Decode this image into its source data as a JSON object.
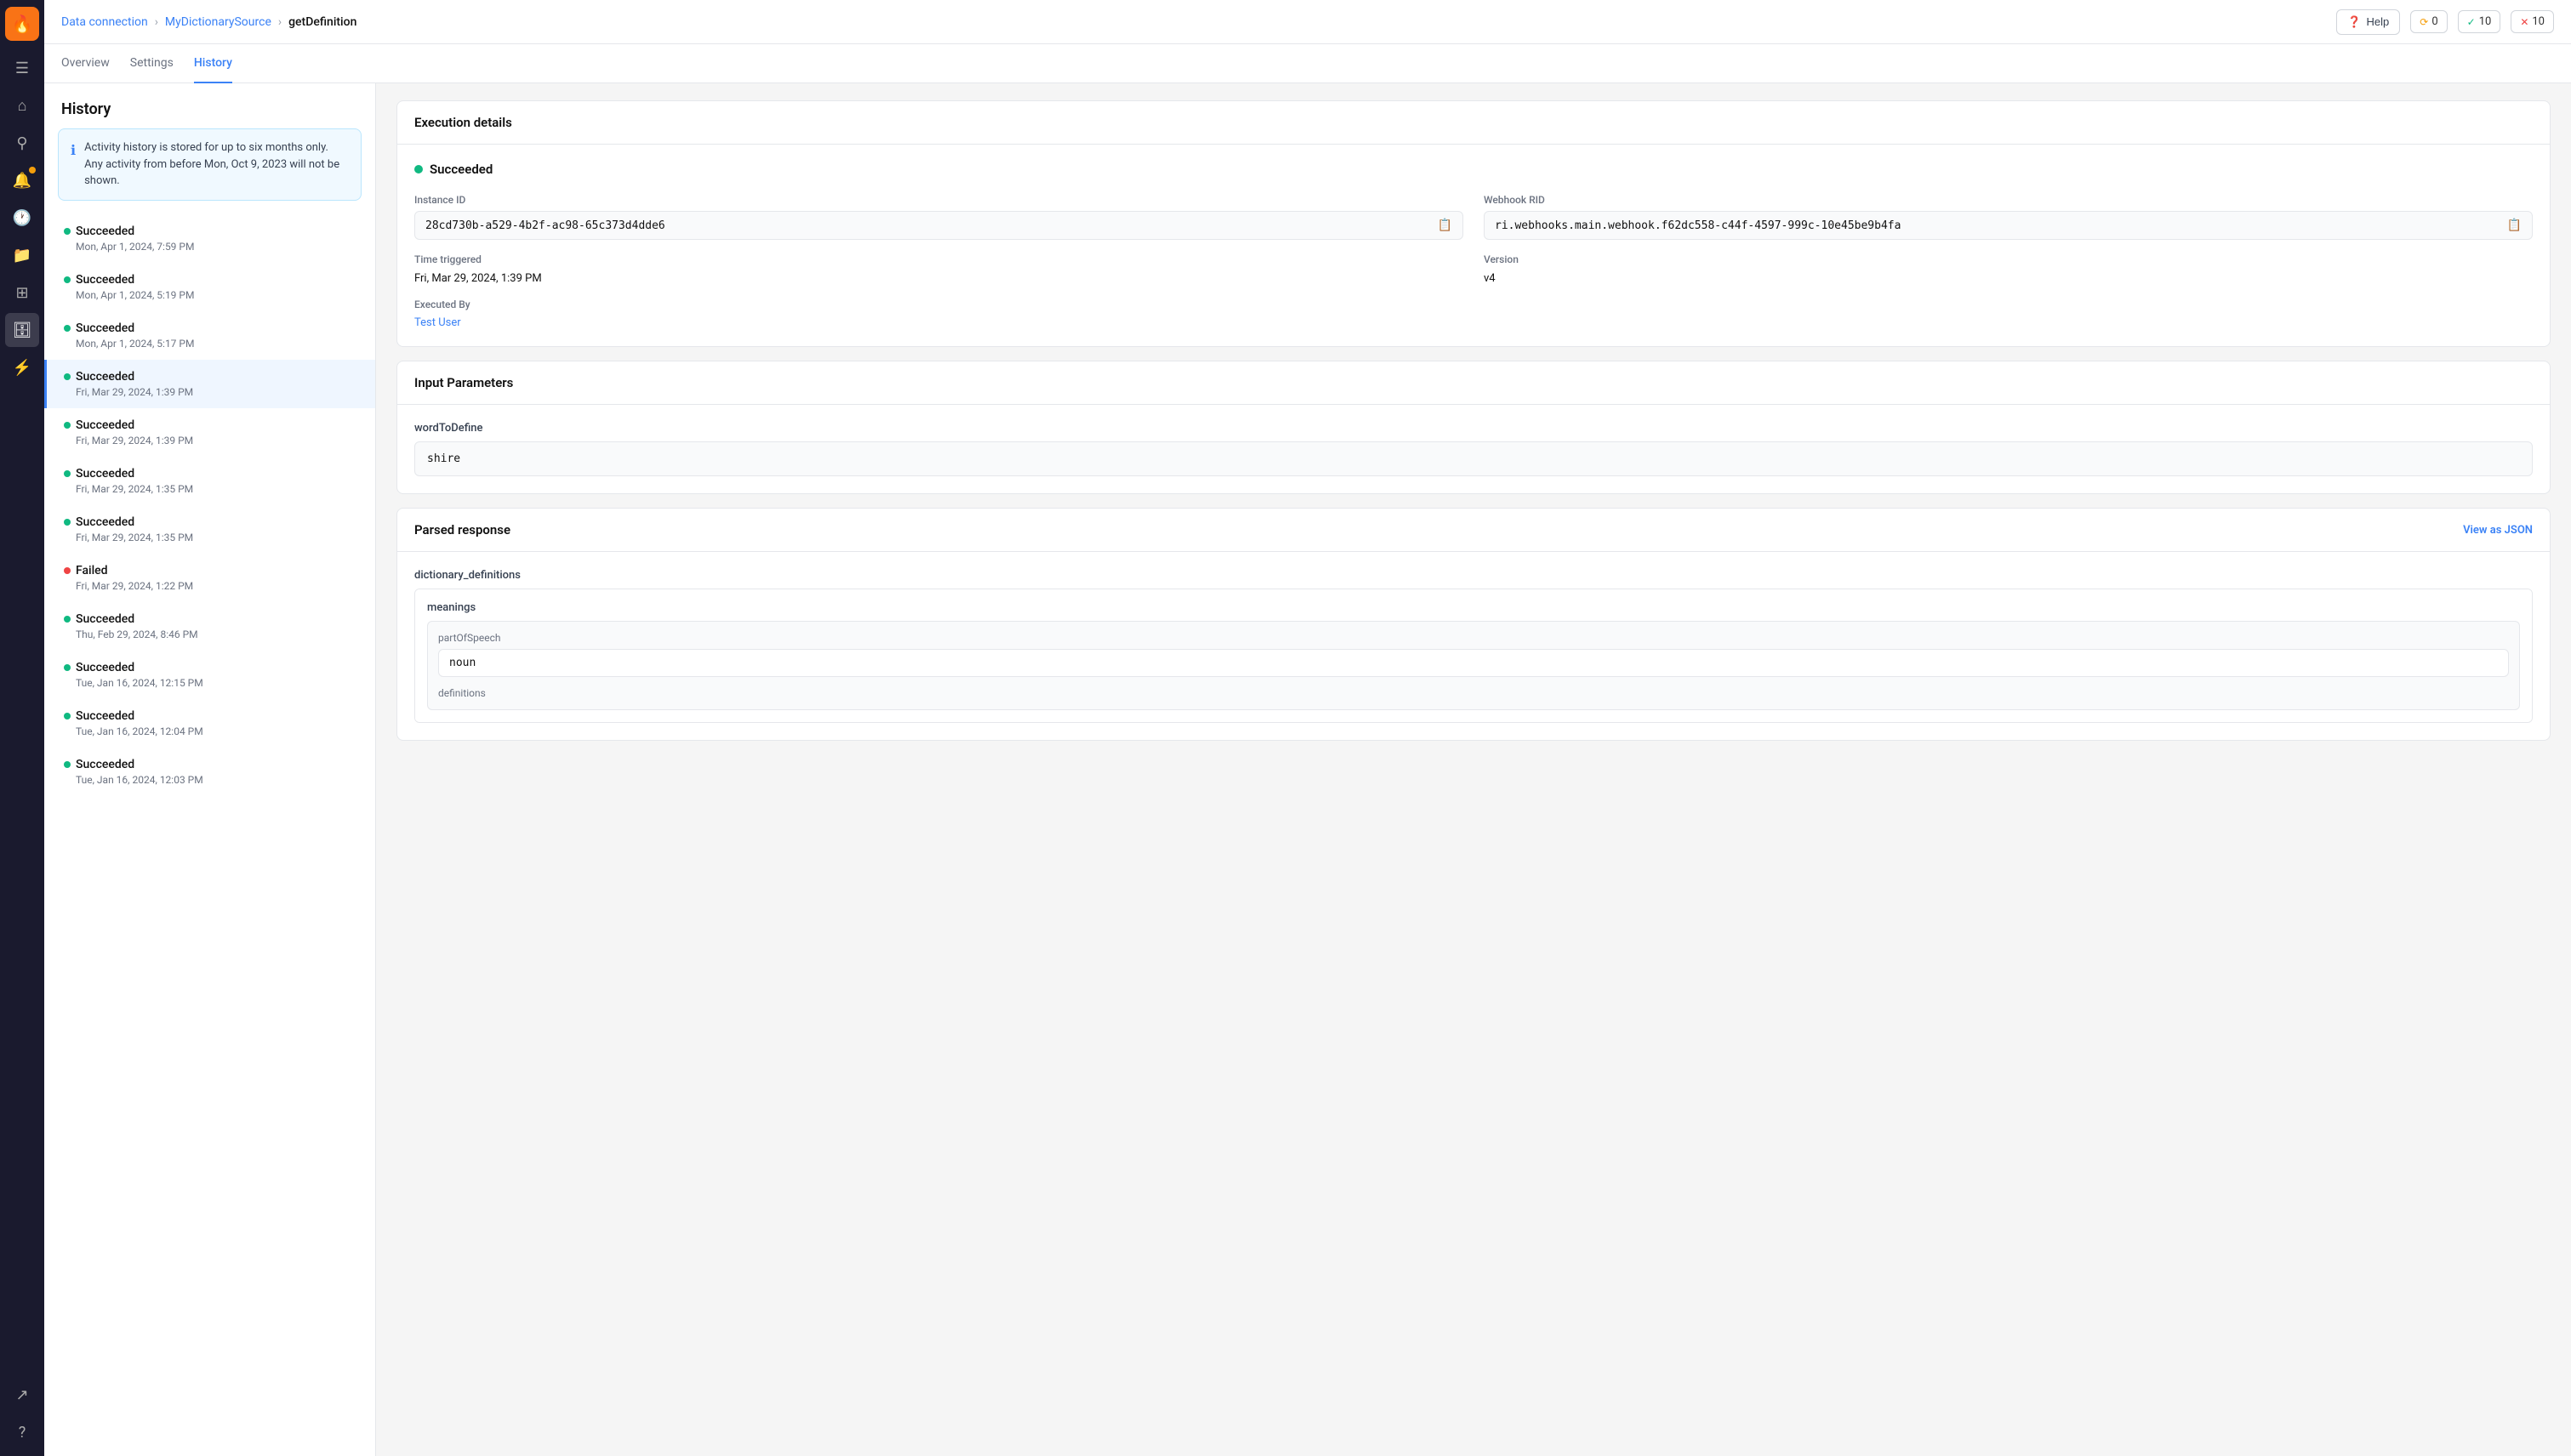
{
  "app": {
    "logo": "🔥"
  },
  "topbar": {
    "breadcrumb": {
      "part1": "Data connection",
      "part2": "MyDictionarySource",
      "part3": "getDefinition"
    },
    "help_label": "Help",
    "status_warn": "0",
    "status_success": "10",
    "status_error": "10"
  },
  "tabs": [
    {
      "id": "overview",
      "label": "Overview"
    },
    {
      "id": "settings",
      "label": "Settings"
    },
    {
      "id": "history",
      "label": "History"
    }
  ],
  "history_pane": {
    "title": "History",
    "info_banner": "Activity history is stored for up to six months only. Any activity from before Mon, Oct 9, 2023 will not be shown.",
    "items": [
      {
        "status": "success",
        "label": "Succeeded",
        "timestamp": "Mon, Apr 1, 2024, 7:59 PM"
      },
      {
        "status": "success",
        "label": "Succeeded",
        "timestamp": "Mon, Apr 1, 2024, 5:19 PM"
      },
      {
        "status": "success",
        "label": "Succeeded",
        "timestamp": "Mon, Apr 1, 2024, 5:17 PM"
      },
      {
        "status": "success",
        "label": "Succeeded",
        "timestamp": "Fri, Mar 29, 2024, 1:39 PM"
      },
      {
        "status": "success",
        "label": "Succeeded",
        "timestamp": "Fri, Mar 29, 2024, 1:39 PM"
      },
      {
        "status": "success",
        "label": "Succeeded",
        "timestamp": "Fri, Mar 29, 2024, 1:35 PM"
      },
      {
        "status": "success",
        "label": "Succeeded",
        "timestamp": "Fri, Mar 29, 2024, 1:35 PM"
      },
      {
        "status": "failed",
        "label": "Failed",
        "timestamp": "Fri, Mar 29, 2024, 1:22 PM"
      },
      {
        "status": "success",
        "label": "Succeeded",
        "timestamp": "Thu, Feb 29, 2024, 8:46 PM"
      },
      {
        "status": "success",
        "label": "Succeeded",
        "timestamp": "Tue, Jan 16, 2024, 12:15 PM"
      },
      {
        "status": "success",
        "label": "Succeeded",
        "timestamp": "Tue, Jan 16, 2024, 12:04 PM"
      },
      {
        "status": "success",
        "label": "Succeeded",
        "timestamp": "Tue, Jan 16, 2024, 12:03 PM"
      }
    ]
  },
  "execution_details": {
    "card_title": "Execution details",
    "status_label": "Succeeded",
    "instance_id_label": "Instance ID",
    "instance_id_value": "28cd730b-a529-4b2f-ac98-65c373d4dde6",
    "webhook_rid_label": "Webhook RID",
    "webhook_rid_value": "ri.webhooks.main.webhook.f62dc558-c44f-4597-999c-10e45be9b4fa",
    "time_triggered_label": "Time triggered",
    "time_triggered_value": "Fri, Mar 29, 2024, 1:39 PM",
    "version_label": "Version",
    "version_value": "v4",
    "executed_by_label": "Executed By",
    "executed_by_value": "Test User"
  },
  "input_parameters": {
    "card_title": "Input Parameters",
    "param_name": "wordToDefine",
    "param_value": "shire"
  },
  "parsed_response": {
    "card_title": "Parsed response",
    "view_json_label": "View as JSON",
    "root_key": "dictionary_definitions",
    "meanings_key": "meanings",
    "part_of_speech_key": "partOfSpeech",
    "part_of_speech_value": "noun",
    "definitions_key": "definitions"
  },
  "sidebar": {
    "icons": [
      {
        "name": "menu-icon",
        "glyph": "☰",
        "active": false
      },
      {
        "name": "home-icon",
        "glyph": "⌂",
        "active": false
      },
      {
        "name": "search-icon",
        "glyph": "🔍",
        "active": false
      },
      {
        "name": "bell-icon",
        "glyph": "🔔",
        "active": false,
        "badge": true
      },
      {
        "name": "history-icon",
        "glyph": "🕐",
        "active": false
      },
      {
        "name": "folder-icon",
        "glyph": "📁",
        "active": false
      },
      {
        "name": "grid-icon",
        "glyph": "⊞",
        "active": false
      },
      {
        "name": "data-icon",
        "glyph": "🗄",
        "active": true
      },
      {
        "name": "transform-icon",
        "glyph": "⚡",
        "active": false
      }
    ],
    "bottom_icons": [
      {
        "name": "external-icon",
        "glyph": "↗",
        "active": false
      },
      {
        "name": "help-icon",
        "glyph": "?",
        "active": false
      }
    ]
  }
}
